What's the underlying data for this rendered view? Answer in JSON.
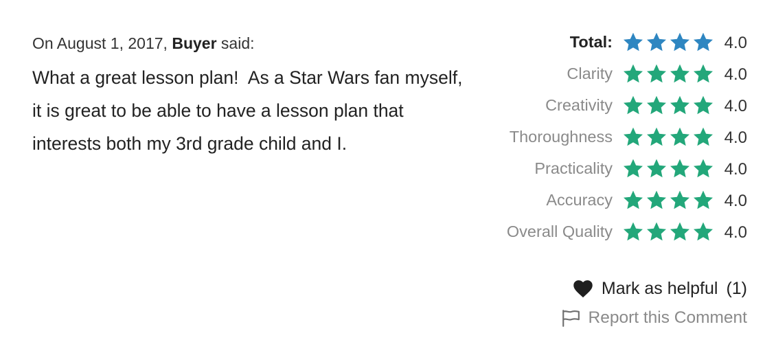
{
  "review": {
    "date_prefix": "On August 1, 2017, ",
    "author": "Buyer",
    "said_suffix": " said:",
    "text": "What a great lesson plan!  As a Star Wars fan myself, it is great to be able to have a lesson plan that interests both my 3rd grade child and I."
  },
  "ratings": {
    "total": {
      "label": "Total:",
      "value": "4.0",
      "stars": 4,
      "star_color": "#2e86c1"
    },
    "items": [
      {
        "label": "Clarity",
        "value": "4.0",
        "stars": 4
      },
      {
        "label": "Creativity",
        "value": "4.0",
        "stars": 4
      },
      {
        "label": "Thoroughness",
        "value": "4.0",
        "stars": 4
      },
      {
        "label": "Practicality",
        "value": "4.0",
        "stars": 4
      },
      {
        "label": "Accuracy",
        "value": "4.0",
        "stars": 4
      },
      {
        "label": "Overall Quality",
        "value": "4.0",
        "stars": 4
      }
    ],
    "item_star_color": "#23a77a"
  },
  "actions": {
    "helpful_label": "Mark as helpful",
    "helpful_count": "(1)",
    "helpful_icon": "heart-icon",
    "report_label": "Report this Comment",
    "report_icon": "flag-icon"
  }
}
